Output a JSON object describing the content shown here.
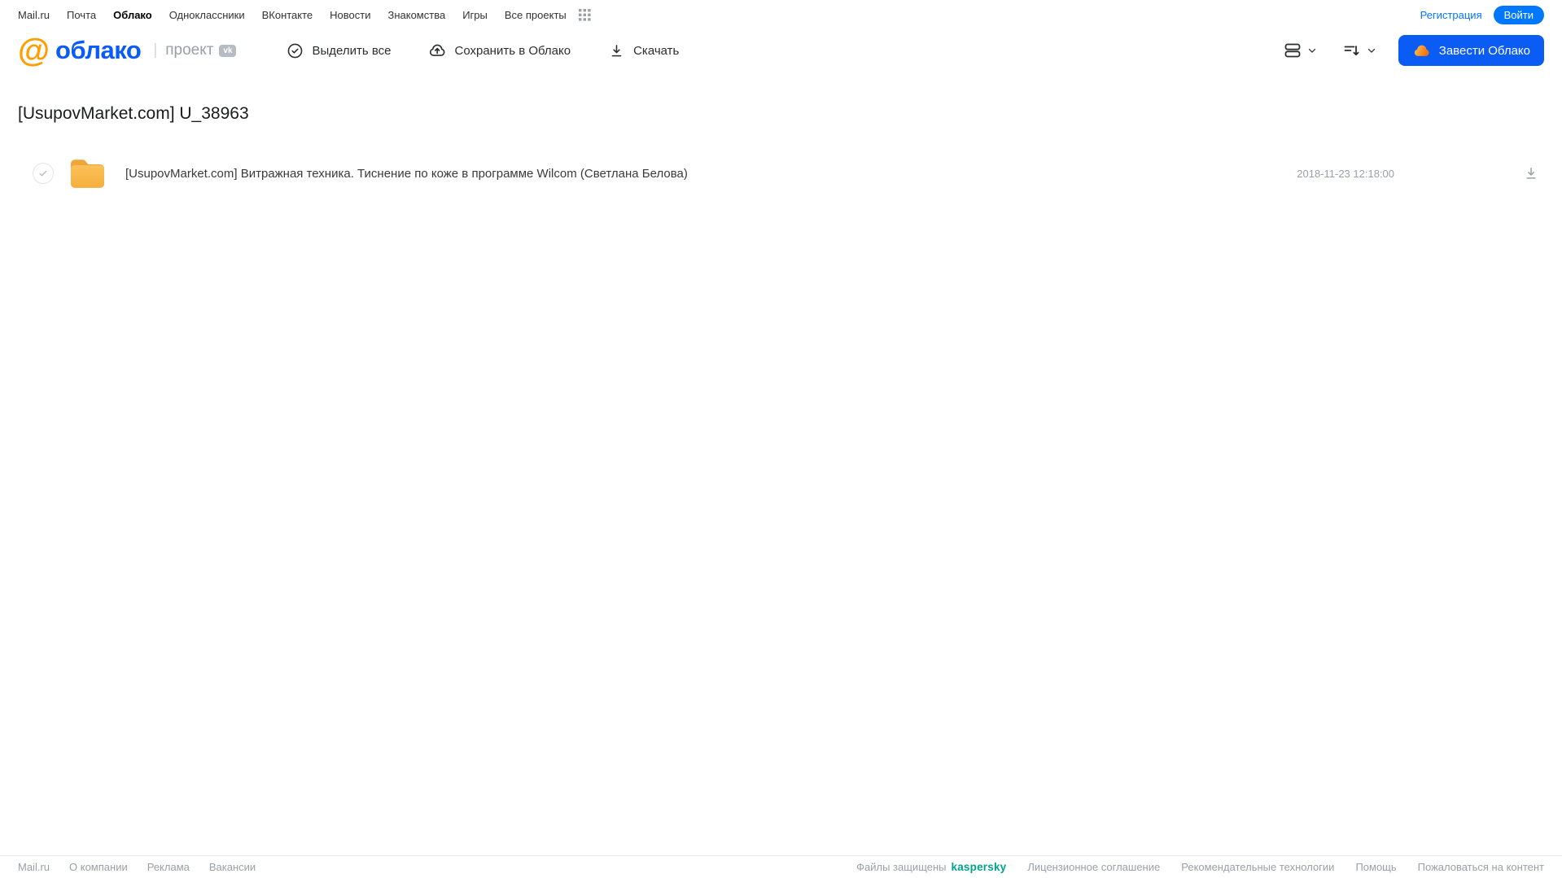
{
  "topnav": {
    "links": [
      "Mail.ru",
      "Почта",
      "Облако",
      "Одноклассники",
      "ВКонтакте",
      "Новости",
      "Знакомства",
      "Игры",
      "Все проекты"
    ],
    "registration": "Регистрация",
    "login": "Войти"
  },
  "header": {
    "logo_at": "@",
    "logo_text": "облако",
    "project_label": "проект",
    "vk_badge": "vk",
    "toolbar": [
      {
        "label": "Выделить все",
        "icon": "check-circle-icon"
      },
      {
        "label": "Сохранить в Облако",
        "icon": "cloud-upload-icon"
      },
      {
        "label": "Скачать",
        "icon": "download-icon"
      }
    ],
    "view_icon": "view-mode-icon",
    "sort_icon": "sort-icon",
    "create_cloud_button": "Завести Облако"
  },
  "page": {
    "title": "[UsupovMarket.com] U_38963"
  },
  "files": [
    {
      "type": "folder",
      "name": "[UsupovMarket.com] Витражная техника. Тиснение по коже в программе Wilcom (Светлана Белова)",
      "date": "2018-11-23 12:18:00"
    }
  ],
  "footer": {
    "left_links": [
      "Mail.ru",
      "О компании",
      "Реклама",
      "Вакансии"
    ],
    "protected_text": "Файлы защищены",
    "kaspersky": "kaspersky",
    "right_links": [
      "Лицензионное соглашение",
      "Рекомендательные технологии",
      "Помощь",
      "Пожаловаться на контент"
    ]
  },
  "colors": {
    "accent_blue": "#0b5cf5",
    "link_blue": "#0077ff",
    "logo_orange": "#ff9e00",
    "folder_amber": "#f8bc4f",
    "kaspersky_green": "#00a38a",
    "muted_gray": "#9aa0a6"
  }
}
